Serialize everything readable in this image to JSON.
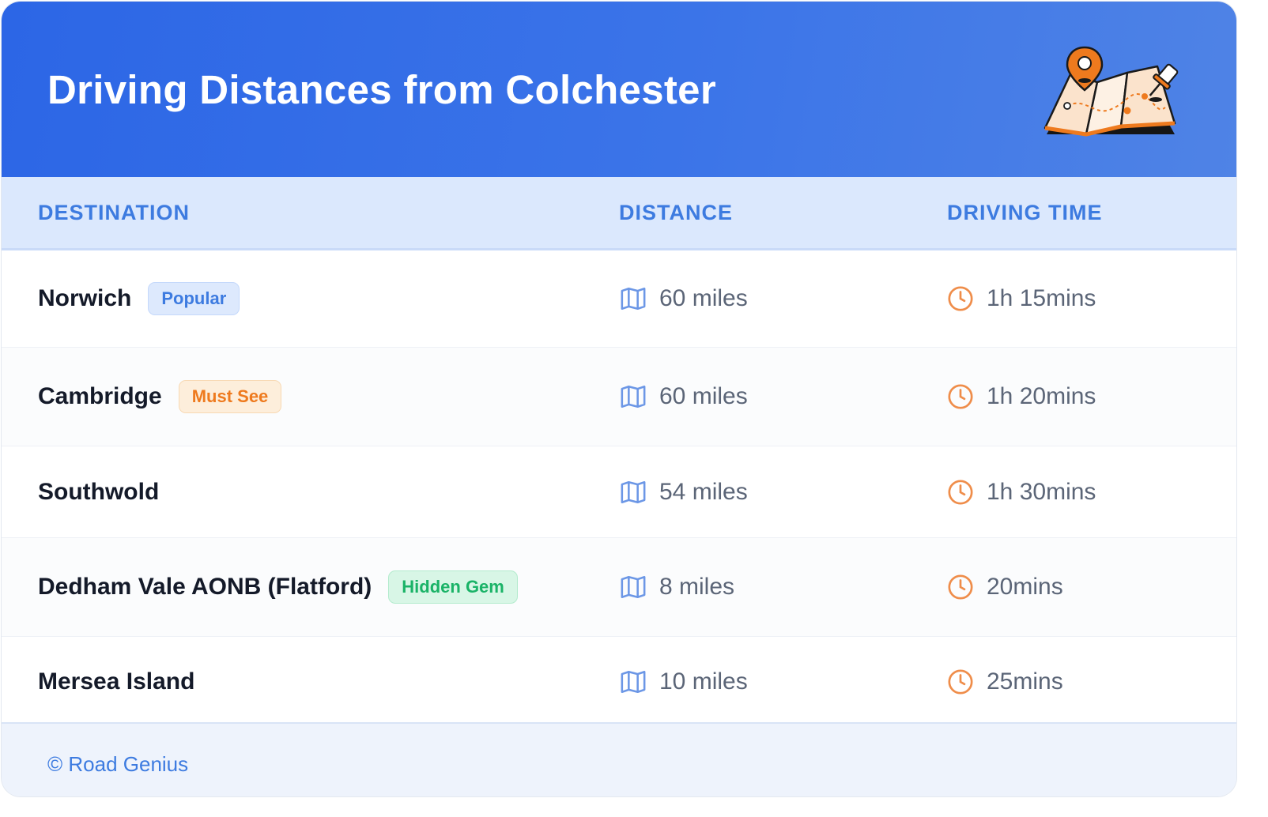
{
  "header": {
    "title": "Driving Distances from Colchester",
    "illustration_icon": "map-with-pins-icon"
  },
  "table": {
    "columns": [
      "DESTINATION",
      "DISTANCE",
      "DRIVING TIME"
    ],
    "rows": [
      {
        "destination": "Norwich",
        "badge": "Popular",
        "badge_color": "blue",
        "distance": "60 miles",
        "time": "1h 15mins"
      },
      {
        "destination": "Cambridge",
        "badge": "Must See",
        "badge_color": "orange",
        "distance": "60 miles",
        "time": "1h 20mins"
      },
      {
        "destination": "Southwold",
        "badge": "",
        "badge_color": "",
        "distance": "54 miles",
        "time": "1h 30mins"
      },
      {
        "destination": "Dedham Vale AONB (Flatford)",
        "badge": "Hidden Gem",
        "badge_color": "green",
        "distance": "8 miles",
        "time": "20mins"
      },
      {
        "destination": "Mersea Island",
        "badge": "",
        "badge_color": "",
        "distance": "10 miles",
        "time": "25mins"
      }
    ]
  },
  "footer": {
    "text": "© Road Genius"
  },
  "colors": {
    "header_bg": "#2c66e6",
    "accent_blue": "#3d7be0",
    "accent_orange": "#ee7a1e",
    "accent_green": "#1ab367"
  },
  "icons": {
    "distance": "map-icon",
    "time": "clock-icon"
  }
}
